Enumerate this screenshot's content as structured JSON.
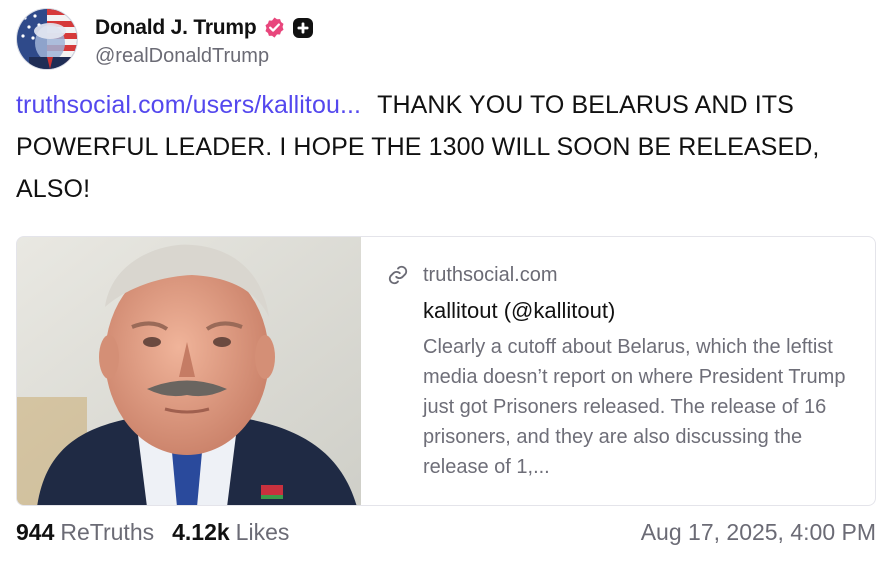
{
  "author": {
    "display_name": "Donald J. Trump",
    "handle": "@realDonaldTrump",
    "avatar_icon": "avatar-flag-portrait",
    "verified_icon": "verified-badge-icon",
    "plus_icon": "plus-badge-icon"
  },
  "post": {
    "link_text": "truthsocial.com/users/kallitou...",
    "text": "THANK YOU TO BELARUS AND ITS POWERFUL LEADER. I HOPE THE 1300 WILL SOON BE RELEASED, ALSO!"
  },
  "link_card": {
    "image_icon": "portrait-photo",
    "domain_icon": "link-icon",
    "domain": "truthsocial.com",
    "title": "kallitout (@kallitout)",
    "description": "Clearly a cutoff about Belarus, which the leftist media doesn’t report on where President Trump just got Prisoners released. The release of 16 prisoners, and they are also discussing the release of 1,..."
  },
  "footer": {
    "retruths_count": "944",
    "retruths_label": "ReTruths",
    "likes_count": "4.12k",
    "likes_label": "Likes",
    "timestamp": "Aug 17, 2025, 4:00 PM"
  },
  "colors": {
    "link": "#5448ee",
    "verified": "#e8467c",
    "muted_text": "#6b6b75",
    "text": "#111111"
  }
}
